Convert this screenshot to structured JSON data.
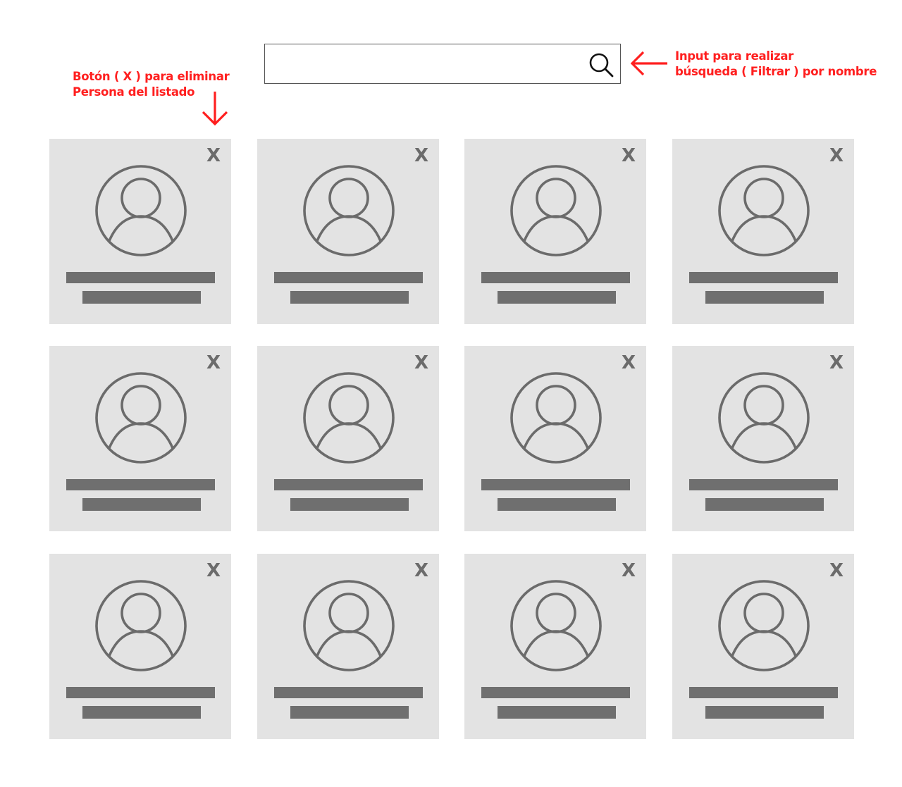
{
  "search": {
    "value": "",
    "placeholder": ""
  },
  "annotations": {
    "delete_button": {
      "line1": "Botón ( X ) para eliminar",
      "line2": "Persona del listado"
    },
    "search_input": {
      "line1": "Input para realizar",
      "line2": "búsqueda ( Filtrar ) por nombre"
    },
    "color": "#ff1f1f"
  },
  "people": [
    {
      "close_label": "X",
      "icon": "user-avatar-icon"
    },
    {
      "close_label": "X",
      "icon": "user-avatar-icon"
    },
    {
      "close_label": "X",
      "icon": "user-avatar-icon"
    },
    {
      "close_label": "X",
      "icon": "user-avatar-icon"
    },
    {
      "close_label": "X",
      "icon": "user-avatar-icon"
    },
    {
      "close_label": "X",
      "icon": "user-avatar-icon"
    },
    {
      "close_label": "X",
      "icon": "user-avatar-icon"
    },
    {
      "close_label": "X",
      "icon": "user-avatar-icon"
    },
    {
      "close_label": "X",
      "icon": "user-avatar-icon"
    },
    {
      "close_label": "X",
      "icon": "user-avatar-icon"
    },
    {
      "close_label": "X",
      "icon": "user-avatar-icon"
    },
    {
      "close_label": "X",
      "icon": "user-avatar-icon"
    }
  ],
  "colors": {
    "card_background": "#e3e3e3",
    "placeholder_bar": "#6f6f6f",
    "icon_stroke": "#6b6b6b"
  }
}
